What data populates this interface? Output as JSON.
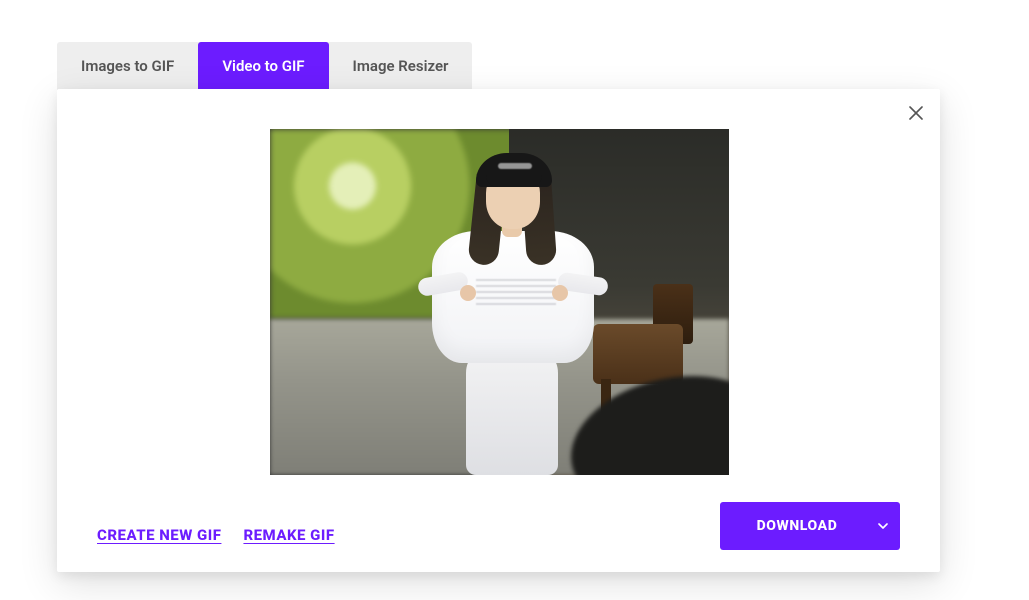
{
  "tabs": [
    {
      "label": "Images to GIF",
      "active": false
    },
    {
      "label": "Video to GIF",
      "active": true
    },
    {
      "label": "Image Resizer",
      "active": false
    }
  ],
  "modal": {
    "close_icon": "close",
    "actions": {
      "create_new": "CREATE NEW GIF",
      "remake": "REMAKE GIF",
      "download": "DOWNLOAD"
    }
  },
  "colors": {
    "accent": "#6c1cff"
  }
}
